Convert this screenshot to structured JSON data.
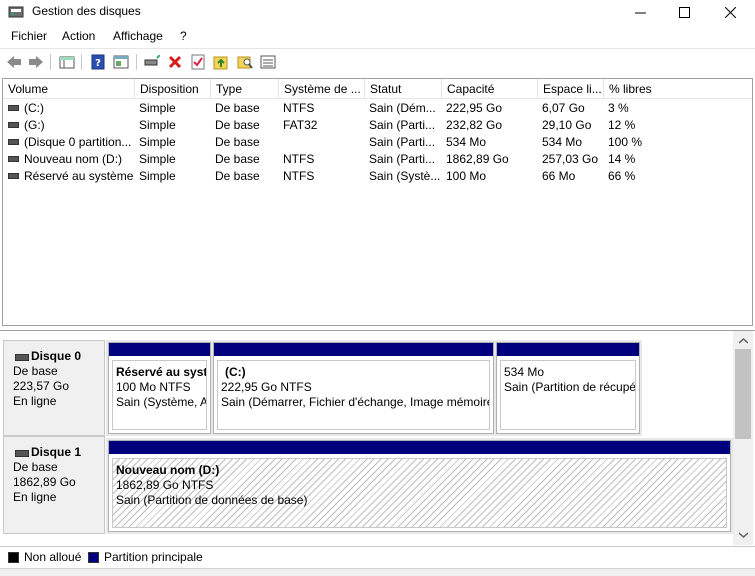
{
  "window": {
    "title": "Gestion des disques"
  },
  "menu": [
    "Fichier",
    "Action",
    "Affichage",
    "?"
  ],
  "toolbar": {
    "icons": [
      "back-icon",
      "forward-icon",
      "view-icon",
      "help-icon",
      "properties-icon",
      "connect-icon",
      "delete-icon",
      "checkmark-icon",
      "folder-up-icon",
      "search-folder-icon",
      "list-icon"
    ]
  },
  "volumes": {
    "columns": [
      "Volume",
      "Disposition",
      "Type",
      "Système de ...",
      "Statut",
      "Capacité",
      "Espace li...",
      "% libres"
    ],
    "rows": [
      [
        "(C:)",
        "Simple",
        "De base",
        "NTFS",
        "Sain (Dém...",
        "222,95 Go",
        "6,07 Go",
        "3 %"
      ],
      [
        "(G:)",
        "Simple",
        "De base",
        "FAT32",
        "Sain (Parti...",
        "232,82 Go",
        "29,10 Go",
        "12 %"
      ],
      [
        "(Disque 0 partition...",
        "Simple",
        "De base",
        "",
        "Sain (Parti...",
        "534 Mo",
        "534 Mo",
        "100 %"
      ],
      [
        "Nouveau nom (D:)",
        "Simple",
        "De base",
        "NTFS",
        "Sain (Parti...",
        "1862,89 Go",
        "257,03 Go",
        "14 %"
      ],
      [
        "Réservé au système",
        "Simple",
        "De base",
        "NTFS",
        "Sain (Systè...",
        "100 Mo",
        "66 Mo",
        "66 %"
      ]
    ]
  },
  "disks": [
    {
      "name": "Disque 0",
      "type": "De base",
      "size": "223,57 Go",
      "status": "En ligne",
      "partitions": [
        {
          "name": "Réservé au systè",
          "size": "100 Mo NTFS",
          "status": "Sain (Système, Ac"
        },
        {
          "name": "(C:)",
          "size": "222,95 Go NTFS",
          "status": "Sain (Démarrer, Fichier d'échange, Image mémoire"
        },
        {
          "name": "",
          "size": "534 Mo",
          "status": "Sain (Partition de récupé"
        }
      ]
    },
    {
      "name": "Disque 1",
      "type": "De base",
      "size": "1862,89 Go",
      "status": "En ligne",
      "partitions": [
        {
          "name": "Nouveau nom  (D:)",
          "size": "1862,89 Go NTFS",
          "status": "Sain (Partition de données de base)"
        }
      ]
    }
  ],
  "legend": {
    "unallocated": "Non alloué",
    "primary": "Partition principale",
    "unallocated_color": "#000000",
    "primary_color": "#00007f"
  }
}
